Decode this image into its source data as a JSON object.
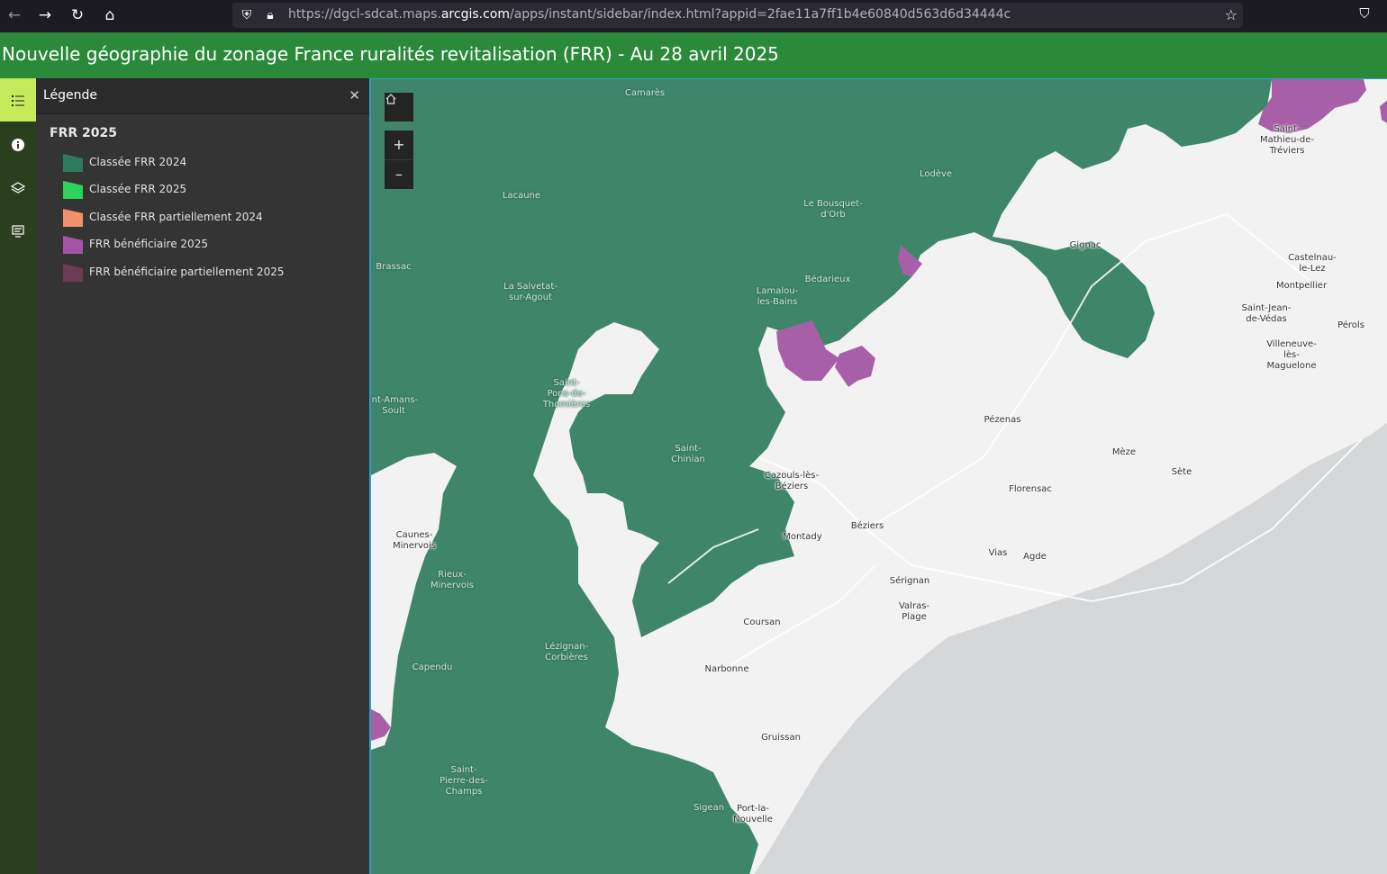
{
  "browser": {
    "url_prefix": "https://dgcl-sdcat.maps.",
    "url_host": "arcgis.com",
    "url_suffix": "/apps/instant/sidebar/index.html?appid=2fae11a7ff1b4e60840d563d6d34444c"
  },
  "app": {
    "title": "Nouvelle géographie du zonage France ruralités revitalisation (FRR) - Au 28 avril 2025"
  },
  "rail": {
    "buttons": [
      {
        "name": "legend",
        "icon": "list-icon"
      },
      {
        "name": "details",
        "icon": "info-icon"
      },
      {
        "name": "layers",
        "icon": "layers-icon"
      },
      {
        "name": "basemap",
        "icon": "basemap-icon"
      }
    ]
  },
  "legend": {
    "panel_title": "Légende",
    "layer_title": "FRR 2025",
    "items": [
      {
        "label": "Classée FRR 2024",
        "color": "#2e7a5c"
      },
      {
        "label": "Classée FRR 2025",
        "color": "#2fd15b"
      },
      {
        "label": "Classée FRR partiellement 2024",
        "color": "#f2906c"
      },
      {
        "label": "FRR bénéficiaire 2025",
        "color": "#a453a6"
      },
      {
        "label": "FRR bénéficiaire partiellement 2025",
        "color": "#6e3b54"
      }
    ]
  },
  "map": {
    "zoom_in": "+",
    "zoom_out": "–",
    "colors": {
      "frr2024": "#3f8569",
      "beneficiaire": "#a760a8",
      "land": "#f2f2f2",
      "sea": "#d5d7d8"
    },
    "places": [
      {
        "name": "Camarès",
        "dark": true
      },
      {
        "name": "Lodève",
        "dark": true
      },
      {
        "name": "Lacaune",
        "dark": true
      },
      {
        "name": "Le Bousquet-\nd'Orb",
        "dark": true
      },
      {
        "name": "Brassac",
        "dark": true
      },
      {
        "name": "Bédarieux",
        "dark": true
      },
      {
        "name": "La Salvetat-\nsur-Agout",
        "dark": true
      },
      {
        "name": "Lamalou-\nles-Bains",
        "dark": true
      },
      {
        "name": "Saint-\nPons-de-\nThomières",
        "dark": true
      },
      {
        "name": "int-Amans-\nSoult",
        "dark": true
      },
      {
        "name": "Saint-\nChinian",
        "dark": true
      },
      {
        "name": "Rieux-\nMinervois",
        "dark": true
      },
      {
        "name": "Capendu",
        "dark": true
      },
      {
        "name": "Lézignan-\nCorbières",
        "dark": true
      },
      {
        "name": "Saint-\nPierre-des-\nChamps",
        "dark": true
      },
      {
        "name": "Sigean",
        "dark": true
      },
      {
        "name": "Saint-\nMathieu-de-\nTréviers",
        "dark": false
      },
      {
        "name": "Gignac",
        "dark": false
      },
      {
        "name": "Castelnau-\nle-Lez",
        "dark": false
      },
      {
        "name": "Montpellier",
        "dark": false
      },
      {
        "name": "Saint-Jean-\nde-Védas",
        "dark": false
      },
      {
        "name": "Pérols",
        "dark": false
      },
      {
        "name": "Villeneuve-\nlès-\nMaguelone",
        "dark": false
      },
      {
        "name": "Pézenas",
        "dark": false
      },
      {
        "name": "Mèze",
        "dark": false
      },
      {
        "name": "Sète",
        "dark": false
      },
      {
        "name": "Cazouls-lès-\nBéziers",
        "dark": false
      },
      {
        "name": "Florensac",
        "dark": false
      },
      {
        "name": "Béziers",
        "dark": false
      },
      {
        "name": "Montady",
        "dark": false
      },
      {
        "name": "Vias",
        "dark": false
      },
      {
        "name": "Agde",
        "dark": false
      },
      {
        "name": "Sérignan",
        "dark": false
      },
      {
        "name": "Valras-\nPlage",
        "dark": false
      },
      {
        "name": "Caunes-\nMinervois",
        "dark": false
      },
      {
        "name": "Coursan",
        "dark": false
      },
      {
        "name": "Narbonne",
        "dark": false
      },
      {
        "name": "Gruissan",
        "dark": false
      },
      {
        "name": "Port-la-\nNouvelle",
        "dark": false
      }
    ]
  }
}
